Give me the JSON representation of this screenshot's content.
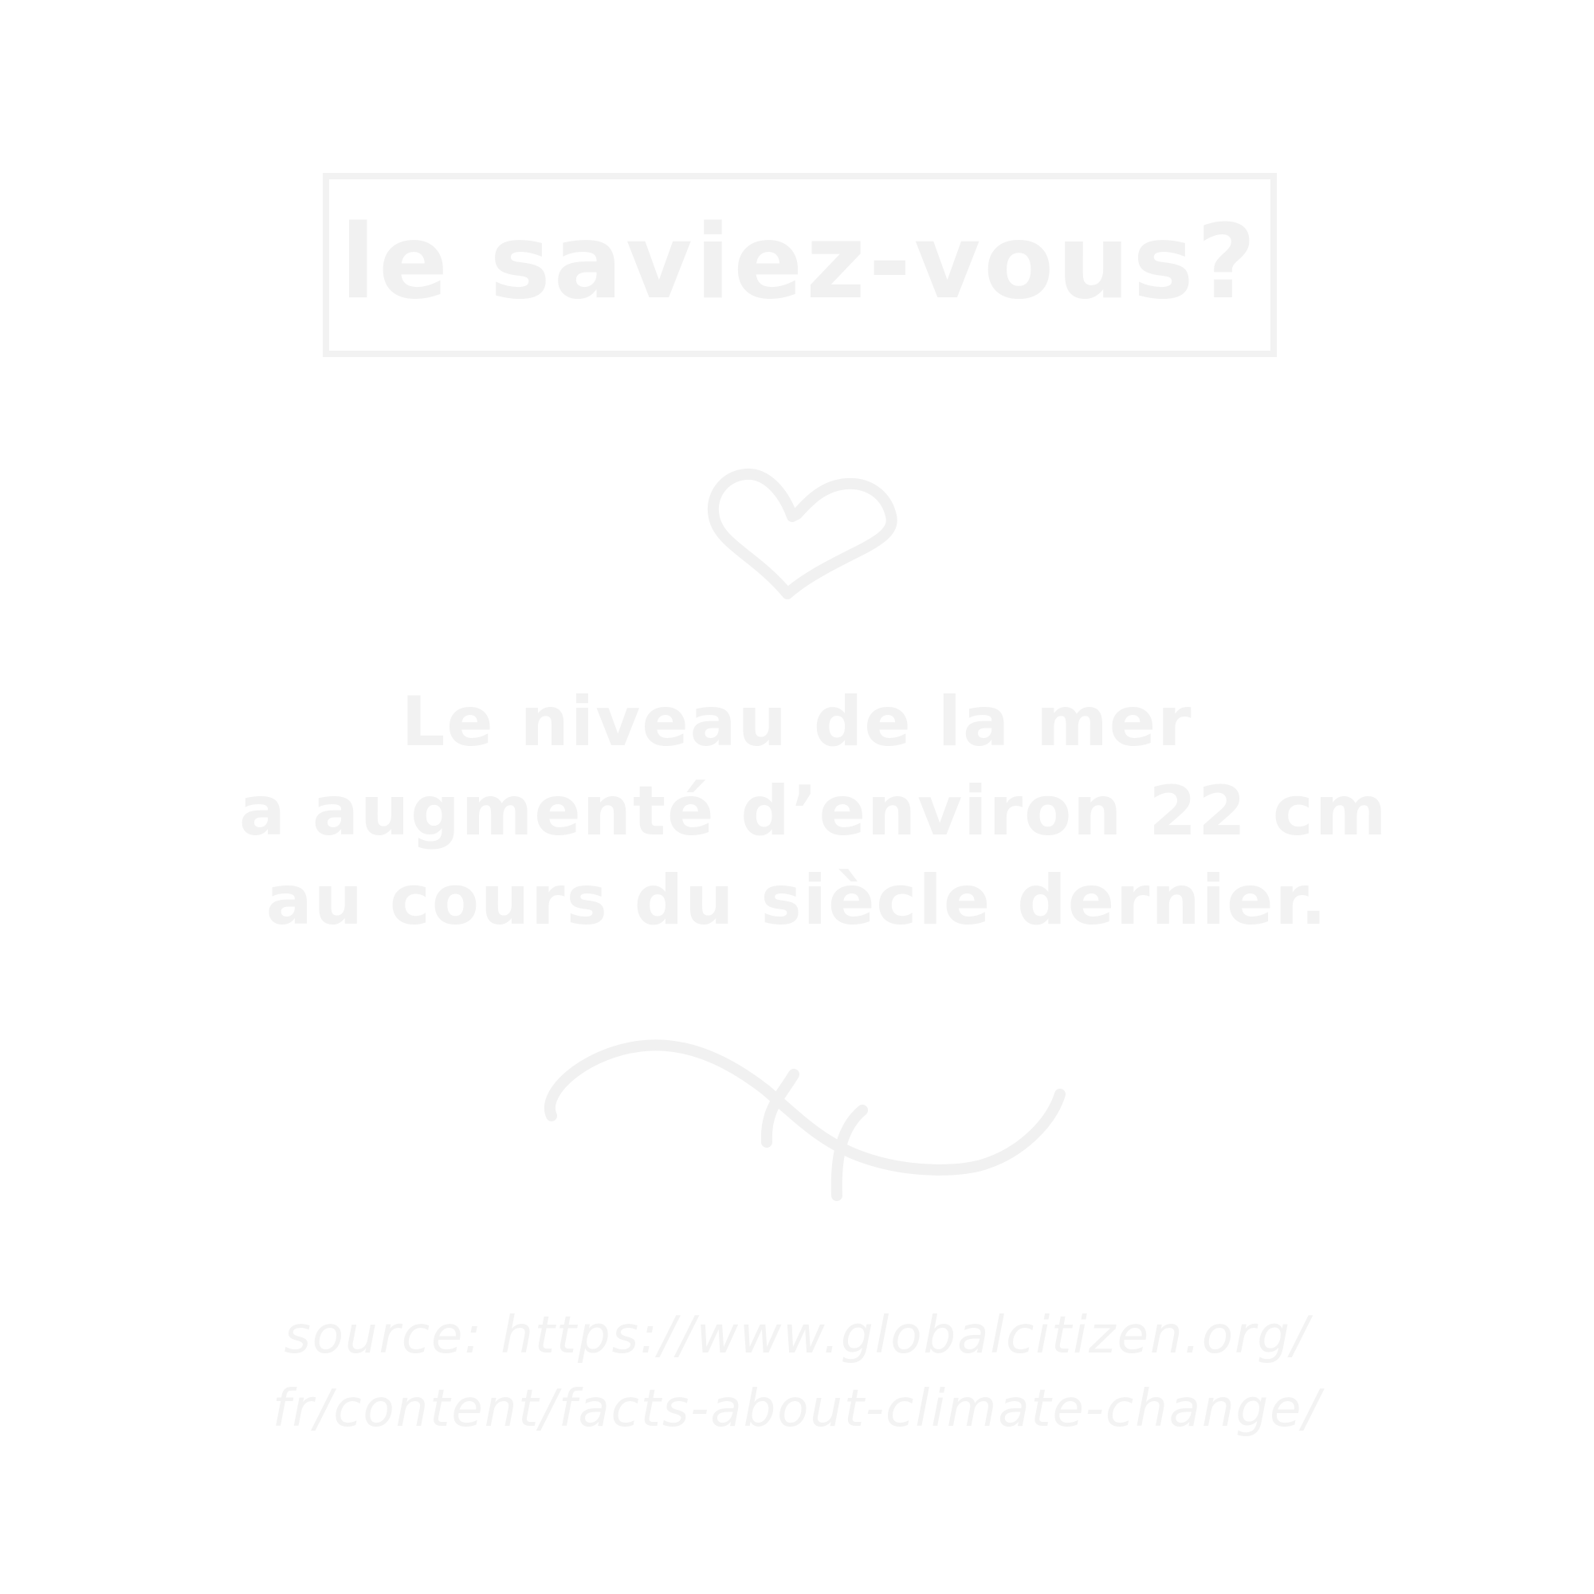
{
  "title": "le saviez-vous?",
  "fact": {
    "line1": "Le niveau de la mer",
    "line2": "a augmenté d’environ 22 cm",
    "line3": "au cours du siècle dernier."
  },
  "source": {
    "line1": "source: https://www.globalcitizen.org/",
    "line2": "fr/content/facts-about-climate-change/"
  },
  "decorations": {
    "top_icon": "heart-icon",
    "bottom_icon": "flourish-icon"
  },
  "colors": {
    "background": "#ffffff",
    "ink": "#f1f1f1"
  }
}
